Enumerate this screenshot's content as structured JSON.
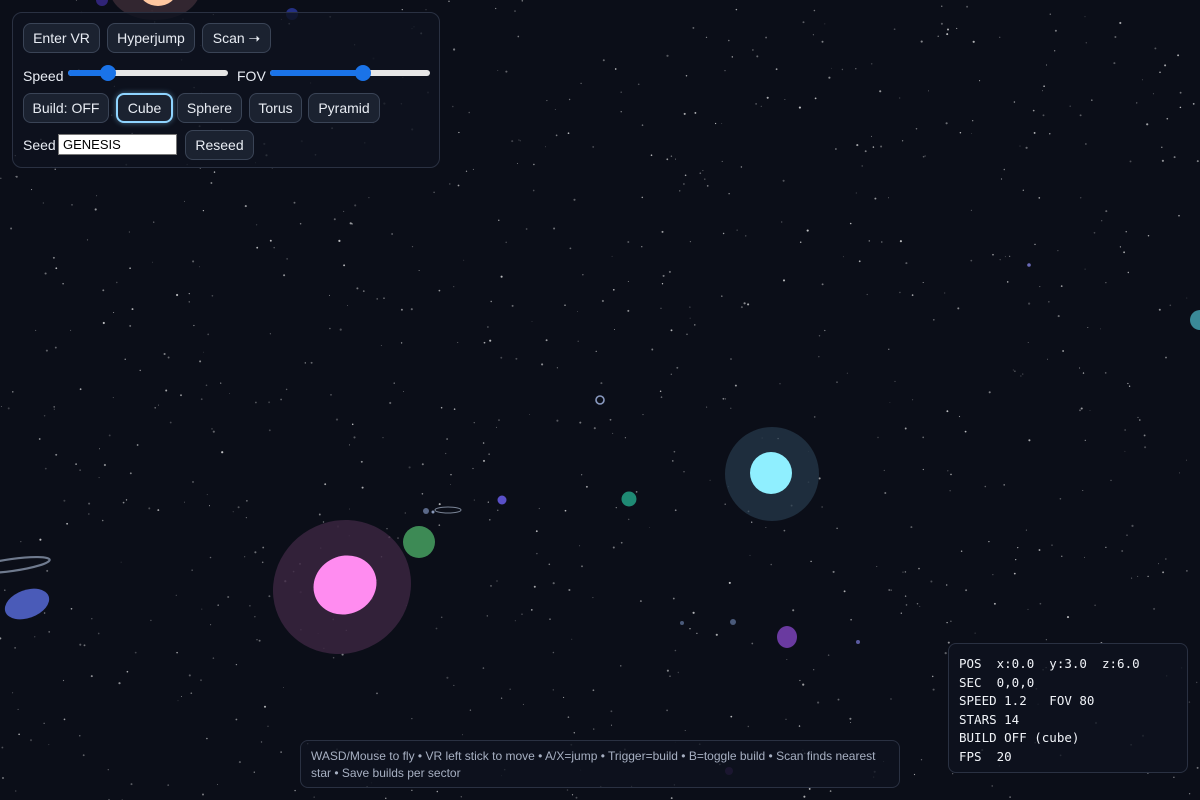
{
  "toolbar": {
    "enter_vr": "Enter VR",
    "hyperjump": "Hyperjump",
    "scan": "Scan ➝"
  },
  "controls": {
    "speed_label": "Speed",
    "speed_level": 0.25,
    "fov_label": "FOV",
    "fov_level": 0.58
  },
  "build": {
    "toggle_label": "Build: OFF",
    "shapes": [
      "Cube",
      "Sphere",
      "Torus",
      "Pyramid"
    ],
    "selected_shape": "Cube"
  },
  "seed": {
    "label": "Seed",
    "value": "GENESIS",
    "reseed_label": "Reseed"
  },
  "help": {
    "text": "WASD/Mouse to fly • VR left stick to move • A/X=jump • Trigger=build • B=toggle build • Scan finds nearest star • Save builds per sector"
  },
  "hud": {
    "pos": "POS  x:0.0  y:3.0  z:6.0",
    "sec": "SEC  0,0,0",
    "speed": "SPEED 1.2   FOV 80",
    "stars": "STARS 14",
    "build": "BUILD OFF (cube)",
    "fps": "FPS  20"
  },
  "colors": {
    "background": "#0b0e18",
    "accent": "#1a73e8",
    "active_border": "#8fd4ff",
    "star_pink": "#ff8cf0",
    "star_cyan": "#8fefff",
    "planet_green": "#3d8a55",
    "planet_teal": "#1f8a74",
    "planet_blue": "#4a5bb8",
    "planet_purple": "#6a3aa0"
  }
}
